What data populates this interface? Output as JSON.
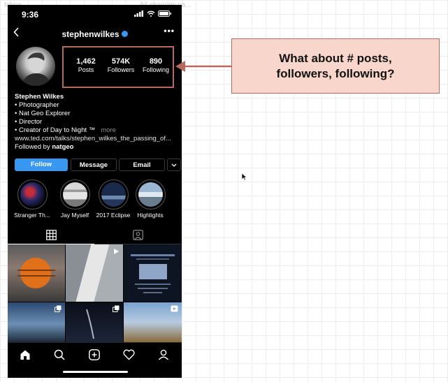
{
  "canvas": {
    "hint_left": "Inbox",
    "hint_right": "All changes sa..."
  },
  "status_bar": {
    "time": "9:36"
  },
  "profile": {
    "username": "stephenwilkes",
    "stats": [
      {
        "value": "1,462",
        "label": "Posts"
      },
      {
        "value": "574K",
        "label": "Followers"
      },
      {
        "value": "890",
        "label": "Following"
      }
    ],
    "bio": {
      "name": "Stephen Wilkes",
      "lines": [
        "• Photographer",
        "• Nat Geo Explorer",
        "• Director",
        "• Creator of Day to Night ™"
      ],
      "more": "more",
      "link": "www.ted.com/talks/stephen_wilkes_the_passing_of...",
      "followed_prefix": "Followed by ",
      "followed_by": "natgeo"
    },
    "buttons": {
      "follow": "Follow",
      "message": "Message",
      "email": "Email"
    }
  },
  "highlights": [
    {
      "label": "Stranger Th..."
    },
    {
      "label": "Jay Myself"
    },
    {
      "label": "2017 Eclipse"
    },
    {
      "label": "Highlights"
    }
  ],
  "callout": {
    "text": "What about # posts,\nfollowers, following?"
  },
  "colors": {
    "accent": "#3897f0",
    "annotation_border": "#b8685e",
    "callout_fill": "#f9d6cc"
  },
  "icons": {
    "status": [
      "signal-icon",
      "wifi-icon",
      "battery-icon"
    ],
    "nav": [
      "back-chevron-icon",
      "verified-badge-icon",
      "more-options-icon"
    ],
    "tabs": [
      "grid-icon",
      "tagged-icon"
    ],
    "bottom_nav": [
      "home-icon",
      "search-icon",
      "add-post-icon",
      "heart-icon",
      "profile-icon"
    ]
  }
}
